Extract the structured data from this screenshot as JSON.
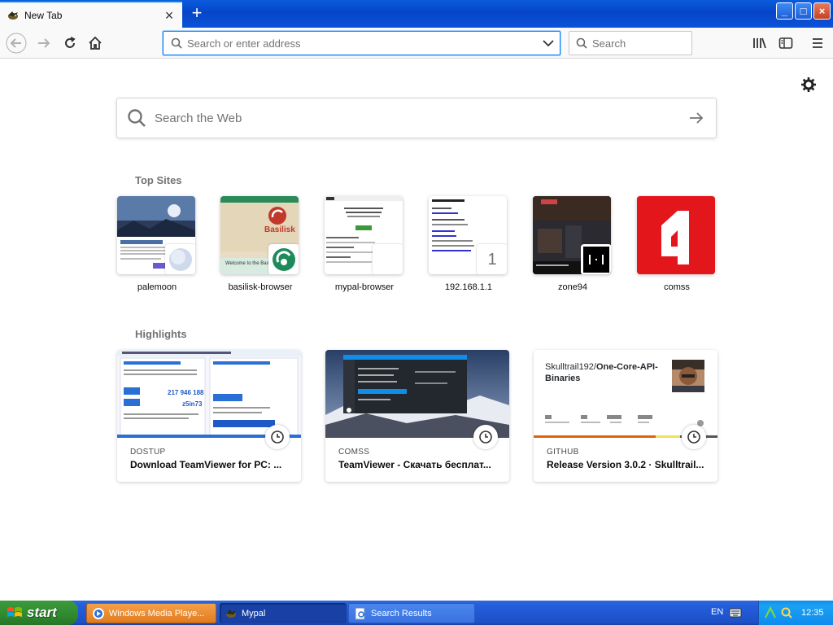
{
  "browser": {
    "tab": {
      "title": "New Tab",
      "close": "×"
    },
    "new_tab": "+",
    "window_buttons": {
      "minimize": "_",
      "maximize": "□",
      "close": "×"
    },
    "url_placeholder": "Search or enter address",
    "search_placeholder": "Search"
  },
  "newtab": {
    "web_search_placeholder": "Search the Web",
    "top_sites_title": "Top Sites",
    "top_sites": [
      {
        "label": "palemoon"
      },
      {
        "label": "basilisk-browser",
        "thumb_text": "Basilisk",
        "thumb_caption": "Welcome to the Basilisk"
      },
      {
        "label": "mypal-browser"
      },
      {
        "label": "192.168.1.1",
        "badge": "1"
      },
      {
        "label": "zone94"
      },
      {
        "label": "comss"
      }
    ],
    "highlights_title": "Highlights",
    "highlights": [
      {
        "source": "DOSTUP",
        "title": "Download TeamViewer for PC: ...",
        "preview": {
          "num1": "217 946 188",
          "num2": "z5in73"
        }
      },
      {
        "source": "COMSS",
        "title": "TeamViewer - Скачать бесплат..."
      },
      {
        "source": "GITHUB",
        "title": "Release Version 3.0.2 · Skulltrail...",
        "preview": {
          "repo_owner": "Skulltrail192/",
          "repo_name": "One-Core-API-Binaries"
        }
      }
    ]
  },
  "taskbar": {
    "start": "start",
    "items": [
      {
        "label": "Windows Media Playe..."
      },
      {
        "label": "Mypal"
      },
      {
        "label": "Search Results"
      }
    ],
    "lang": "EN",
    "clock": "12:35"
  },
  "colors": {
    "accent": "#0a84ff",
    "comss_red": "#e3161c",
    "taskbar": "#245edb",
    "start": "#3c9a3c"
  }
}
